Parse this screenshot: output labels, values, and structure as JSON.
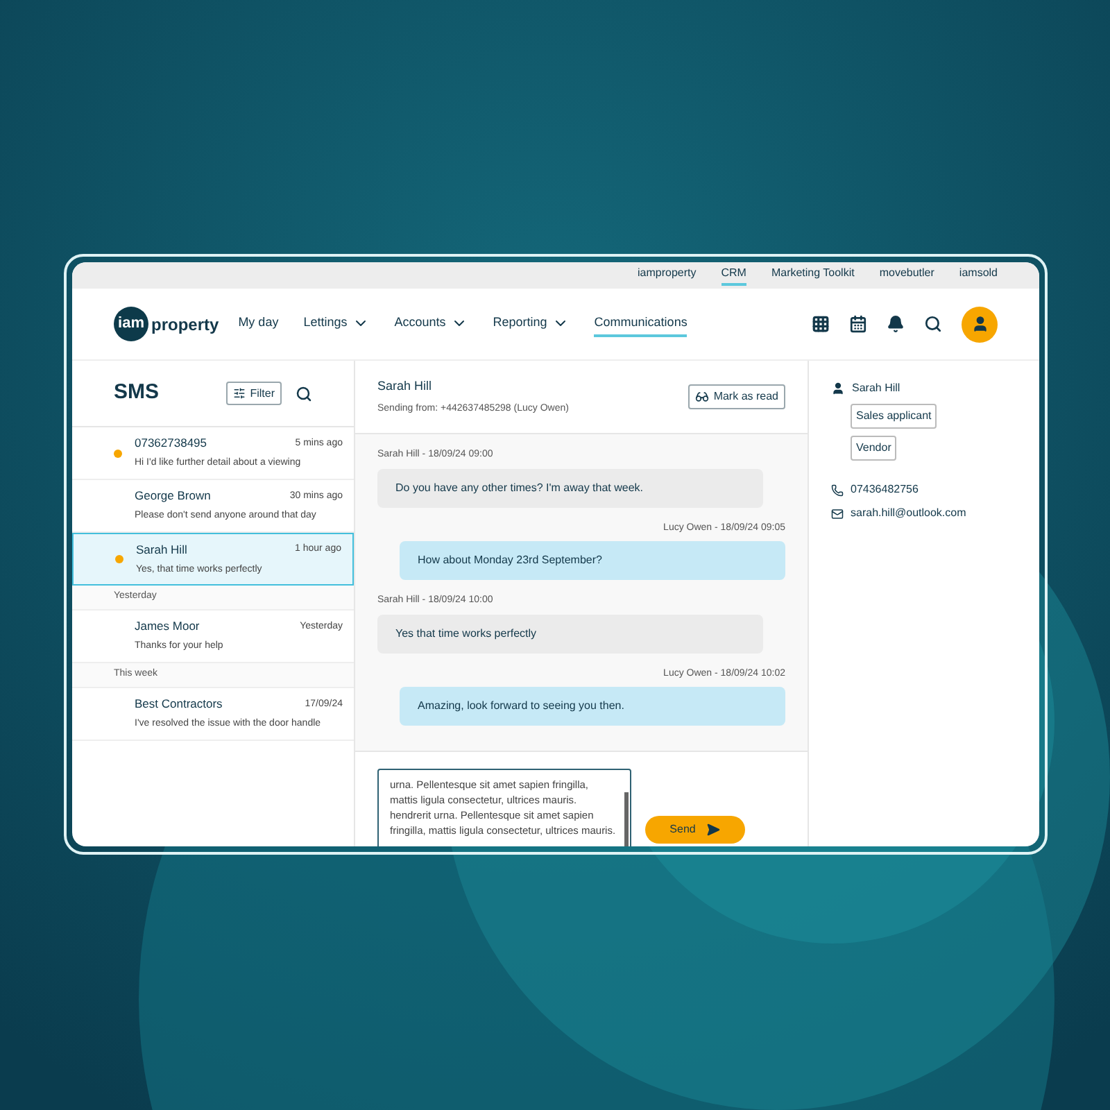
{
  "top_links": [
    {
      "label": "iamproperty",
      "selected": false
    },
    {
      "label": "CRM",
      "selected": true
    },
    {
      "label": "Marketing Toolkit",
      "selected": false
    },
    {
      "label": "movebutler",
      "selected": false
    },
    {
      "label": "iamsold",
      "selected": false
    }
  ],
  "logo": {
    "mark": "iam",
    "word": "property"
  },
  "nav": [
    {
      "label": "My day",
      "has_menu": false,
      "selected": false
    },
    {
      "label": "Lettings",
      "has_menu": true,
      "selected": false
    },
    {
      "label": "Accounts",
      "has_menu": true,
      "selected": false
    },
    {
      "label": "Reporting",
      "has_menu": true,
      "selected": false
    },
    {
      "label": "Communications",
      "has_menu": false,
      "selected": true
    }
  ],
  "sms": {
    "title": "SMS",
    "filter_button": "Filter"
  },
  "conversations": [
    {
      "kind": "conversation",
      "name": "07362738495",
      "time": "5 mins ago",
      "preview": "Hi I'd like further detail about a viewing",
      "unread": true,
      "selected": false
    },
    {
      "kind": "conversation",
      "name": "George Brown",
      "time": "30 mins ago",
      "preview": "Please don't send anyone around that day",
      "unread": false,
      "selected": false
    },
    {
      "kind": "conversation",
      "name": "Sarah Hill",
      "time": "1 hour ago",
      "preview": "Yes, that time works perfectly",
      "unread": true,
      "selected": true
    },
    {
      "kind": "header",
      "label": "Yesterday"
    },
    {
      "kind": "conversation",
      "name": "James Moor",
      "time": "Yesterday",
      "preview": "Thanks for your help",
      "unread": false,
      "selected": false
    },
    {
      "kind": "header",
      "label": "This week"
    },
    {
      "kind": "conversation",
      "name": "Best Contractors",
      "time": "17/09/24",
      "preview": "I've resolved the issue with the door handle",
      "unread": false,
      "selected": false
    }
  ],
  "thread": {
    "name": "Sarah Hill",
    "sending_from": "Sending from: +442637485298 (Lucy Owen)",
    "mark_as_read": "Mark as read"
  },
  "messages": [
    {
      "kind": "incoming",
      "meta": "Sarah Hill - 18/09/24 09:00",
      "text": "Do you have any other times? I'm away that week."
    },
    {
      "kind": "outgoing",
      "meta": "Lucy Owen - 18/09/24 09:05",
      "text": "How about Monday 23rd September?"
    },
    {
      "kind": "incoming",
      "meta": "Sarah Hill - 18/09/24 10:00",
      "text": "Yes that time works perfectly"
    },
    {
      "kind": "outgoing",
      "meta": "Lucy Owen - 18/09/24 10:02",
      "text": "Amazing, look forward to seeing you then."
    }
  ],
  "compose": {
    "value": "urna. Pellentesque sit amet sapien fringilla, mattis ligula consectetur, ultrices mauris. hendrerit urna. Pellentesque sit amet sapien fringilla, mattis ligula consectetur, ultrices mauris.",
    "send_button": "Send"
  },
  "contact": {
    "name": "Sarah Hill",
    "tags": [
      "Sales applicant",
      "Vendor"
    ],
    "phone": "07436482756",
    "email": "sarah.hill@outlook.com"
  }
}
